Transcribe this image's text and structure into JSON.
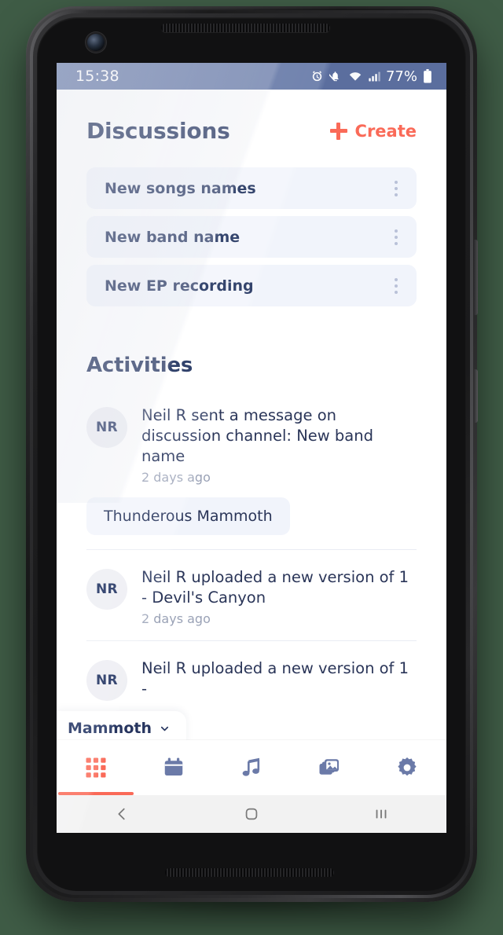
{
  "statusbar": {
    "time": "15:38",
    "battery_percent": "77%",
    "icons": [
      "alarm-icon",
      "bell-muted-icon",
      "wifi-icon",
      "signal-icon",
      "battery-icon"
    ]
  },
  "header": {
    "title": "Discussions",
    "create_label": "Create",
    "create_icon": "plus-icon"
  },
  "discussions": [
    {
      "title": "New songs names",
      "menu_icon": "kebab-menu-icon"
    },
    {
      "title": "New band name",
      "menu_icon": "kebab-menu-icon"
    },
    {
      "title": "New EP recording",
      "menu_icon": "kebab-menu-icon"
    }
  ],
  "activities": {
    "section_title": "Activities",
    "items": [
      {
        "avatar_initials": "NR",
        "text": "Neil R sent a message on discussion channel: New band name",
        "time": "2 days ago",
        "message": "Thunderous Mammoth"
      },
      {
        "avatar_initials": "NR",
        "text": "Neil R uploaded a new version of 1 - Devil's Canyon",
        "time": "2 days ago",
        "message": null
      },
      {
        "avatar_initials": "NR",
        "text": "Neil R uploaded a new version of 1 -",
        "time": "",
        "message": null
      }
    ]
  },
  "project_chip": {
    "label": "Mammoth",
    "icon": "chevron-down-icon"
  },
  "tabbar": {
    "tabs": [
      {
        "name": "grid",
        "icon": "grid-icon",
        "active": true
      },
      {
        "name": "calendar",
        "icon": "calendar-icon",
        "active": false
      },
      {
        "name": "music",
        "icon": "music-note-icon",
        "active": false
      },
      {
        "name": "photos",
        "icon": "photos-icon",
        "active": false
      },
      {
        "name": "settings",
        "icon": "gear-icon",
        "active": false
      }
    ]
  },
  "android_nav": {
    "back": "back-icon",
    "home": "home-icon",
    "recents": "recents-icon"
  },
  "colors": {
    "accent": "#fa6a58",
    "navy": "#1c2a52",
    "card": "#f1f4fb",
    "statusbar": "#5b6e9e",
    "icon_slate": "#6b7aa8",
    "backdrop": "#3f5c46"
  }
}
